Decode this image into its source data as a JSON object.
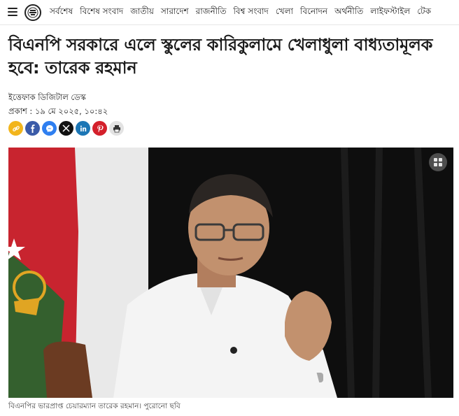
{
  "nav": {
    "items": [
      "সর্বশেষ",
      "বিশেষ সংবাদ",
      "জাতীয়",
      "সারাদেশ",
      "রাজনীতি",
      "বিশ্ব সংবাদ",
      "খেলা",
      "বিনোদন",
      "অর্থনীতি",
      "লাইফস্টাইল",
      "টেক"
    ]
  },
  "article": {
    "headline": "বিএনপি সরকারে এলে স্কুলের কারিকুলামে খেলাধুলা বাধ্যতামূলক হবে: তারেক রহমান",
    "author": "ইত্তেফাক ডিজিটাল ডেস্ক",
    "published": "প্রকাশ : ১৯ মে ২০২৫, ১০:৪২",
    "caption": "বিএনপির ভারপ্রাপ্ত চেয়ারম্যান তারেক রহমান। পুরোনো ছবি"
  },
  "share": [
    {
      "name": "copy-link-icon",
      "color": "#f2b51c"
    },
    {
      "name": "facebook-icon",
      "color": "#3b5ba8"
    },
    {
      "name": "messenger-icon",
      "color": "#2f7ff0"
    },
    {
      "name": "x-icon",
      "color": "#111111"
    },
    {
      "name": "linkedin-icon",
      "color": "#1c76b5"
    },
    {
      "name": "pinterest-icon",
      "color": "#d4202b"
    },
    {
      "name": "print-icon",
      "color": "#e3e3e3"
    }
  ],
  "icons": {
    "menu": "hamburger-icon",
    "logo": "site-logo-icon",
    "gallery": "gallery-grid-icon"
  }
}
